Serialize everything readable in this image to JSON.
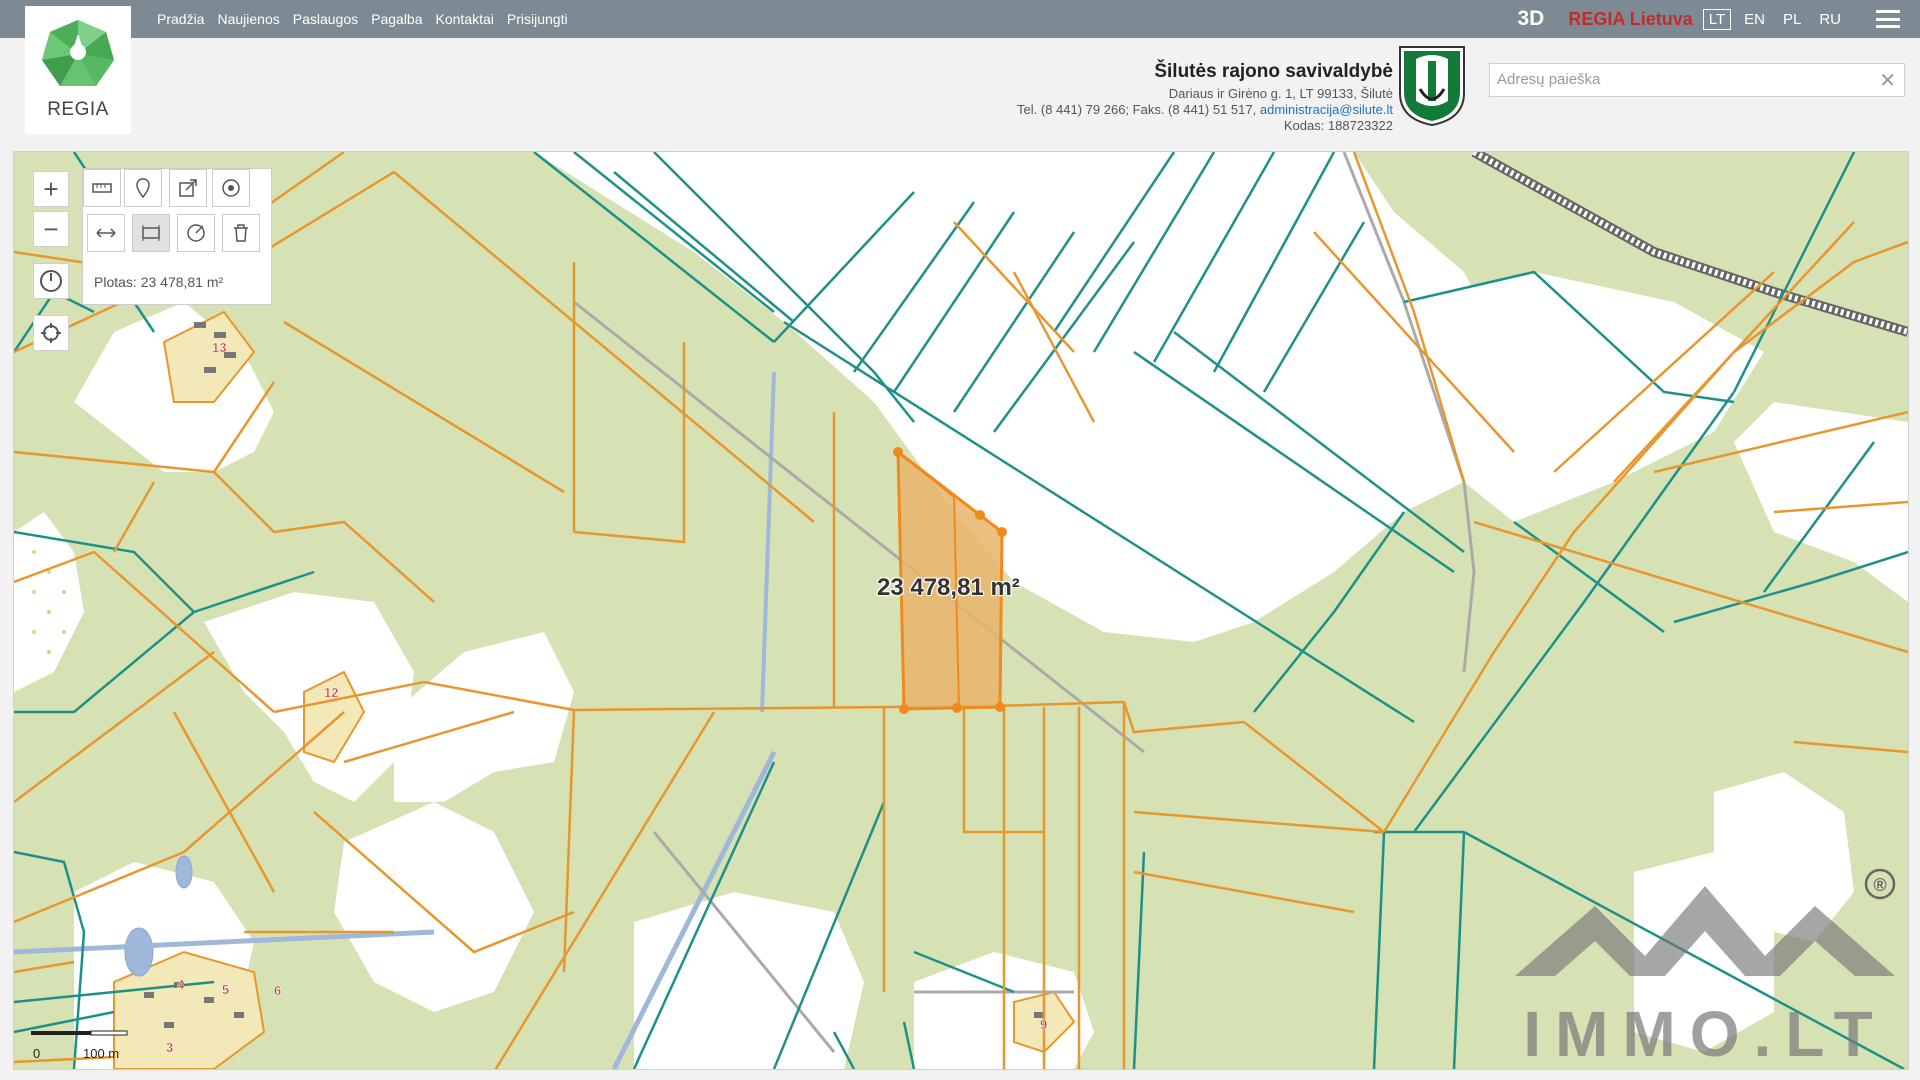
{
  "nav": {
    "items": [
      "Pradžia",
      "Naujienos",
      "Paslaugos",
      "Pagalba",
      "Kontaktai",
      "Prisijungti"
    ],
    "btn3d": "3D",
    "regia_lietuva": "REGIA Lietuva",
    "languages": [
      "LT",
      "EN",
      "PL",
      "RU"
    ],
    "active_language": "LT"
  },
  "logo": {
    "text": "REGIA"
  },
  "municipality": {
    "name": "Šilutės rajono savivaldybė",
    "address": "Dariaus ir Girėno g. 1, LT 99133, Šilutė",
    "phone_fax": "Tel. (8 441) 79 266; Faks. (8 441) 51 517,",
    "email": "administracija@silute.lt",
    "code": "Kodas: 188723322"
  },
  "search": {
    "placeholder": "Adresų paieška",
    "value": ""
  },
  "tools": {
    "area_label": "Plotas: 23 478,81 m²"
  },
  "map": {
    "area_text": "23 478,81 m²",
    "scale_start": "0",
    "scale_end": "100 m",
    "parcel_labels": [
      "13",
      "12",
      "4",
      "5",
      "6",
      "3",
      "9"
    ],
    "colors": {
      "land": "#d6e2b4",
      "forest_white": "#ffffff",
      "orange_line": "#e8962e",
      "teal_line": "#1d9187",
      "water": "#9fb7d8",
      "selection": "#e8b46a"
    }
  },
  "watermark": {
    "text": "IMMO.LT",
    "registered": "®"
  }
}
